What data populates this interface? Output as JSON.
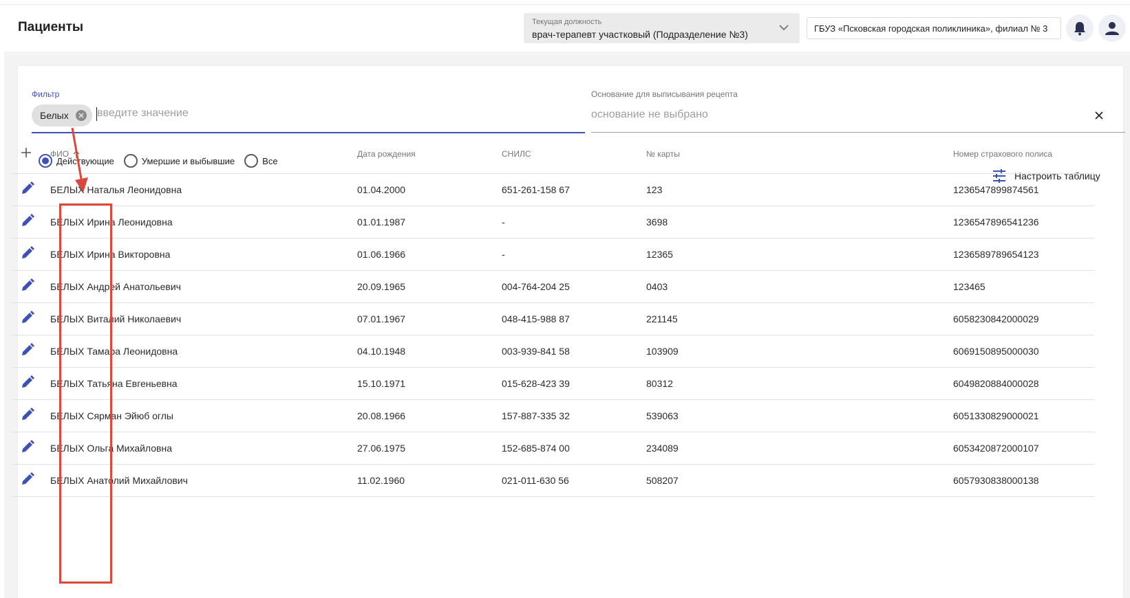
{
  "header": {
    "title": "Пациенты",
    "position_label": "Текущая должность",
    "position_value": "врач-терапевт участковый (Подразделение №3)",
    "organization": "ГБУЗ «Псковская городская поликлиника», филиал № 3"
  },
  "filter": {
    "label": "Фильтр",
    "chip": "Белых",
    "placeholder": "введите значение"
  },
  "basis": {
    "label": "Основание для выписывания рецепта",
    "value": "основание не выбрано",
    "clear_icon": "×"
  },
  "radios": [
    {
      "label": "Действующие",
      "checked": true
    },
    {
      "label": "Умершие и выбывшие",
      "checked": false
    },
    {
      "label": "Все",
      "checked": false
    }
  ],
  "customize_label": "Настроить таблицу",
  "table": {
    "headers": {
      "fio": "ФИО",
      "dob": "Дата рождения",
      "snils": "СНИЛС",
      "card": "№ карты",
      "policy": "Номер страхового полиса"
    },
    "rows": [
      {
        "fio": "БЕЛЫХ Наталья Леонидовна",
        "dob": "01.04.2000",
        "snils": "651-261-158 67",
        "card": "123",
        "policy": "1236547899874561"
      },
      {
        "fio": "БЕЛЫХ Ирина Леонидовна",
        "dob": "01.01.1987",
        "snils": "-",
        "card": "3698",
        "policy": "1236547896541236"
      },
      {
        "fio": "БЕЛЫХ Ирина Викторовна",
        "dob": "01.06.1966",
        "snils": "-",
        "card": "12365",
        "policy": "1236589789654123"
      },
      {
        "fio": "БЕЛЫХ Андрей Анатольевич",
        "dob": "20.09.1965",
        "snils": "004-764-204 25",
        "card": "0403",
        "policy": "123465"
      },
      {
        "fio": "БЕЛЫХ Виталий Николаевич",
        "dob": "07.01.1967",
        "snils": "048-415-988 87",
        "card": "221145",
        "policy": "6058230842000029"
      },
      {
        "fio": "БЕЛЫХ Тамара Леонидовна",
        "dob": "04.10.1948",
        "snils": "003-939-841 58",
        "card": "103909",
        "policy": "6069150895000030"
      },
      {
        "fio": "БЕЛЫХ Татьяна Евгеньевна",
        "dob": "15.10.1971",
        "snils": "015-628-423 39",
        "card": "80312",
        "policy": "6049820884000028"
      },
      {
        "fio": "БЕЛЫХ Сярман Эйюб оглы",
        "dob": "20.08.1966",
        "snils": "157-887-335 32",
        "card": "539063",
        "policy": "6051330829000021"
      },
      {
        "fio": "БЕЛЫХ Ольга Михайловна",
        "dob": "27.06.1975",
        "snils": "152-685-874 00",
        "card": "234089",
        "policy": "6053420872000107"
      },
      {
        "fio": "БЕЛЫХ Анатолий Михайлович",
        "dob": "11.02.1960",
        "snils": "021-011-630 56",
        "card": "508207",
        "policy": "6057930838000138"
      }
    ]
  },
  "colors": {
    "accent": "#3f51b5",
    "annotation": "#d9483b"
  },
  "icons": {
    "edit": "pencil-icon",
    "add": "plus-icon",
    "bell": "bell-icon",
    "user": "user-icon",
    "customize": "sliders-icon",
    "sort": "arrow-up-icon"
  }
}
